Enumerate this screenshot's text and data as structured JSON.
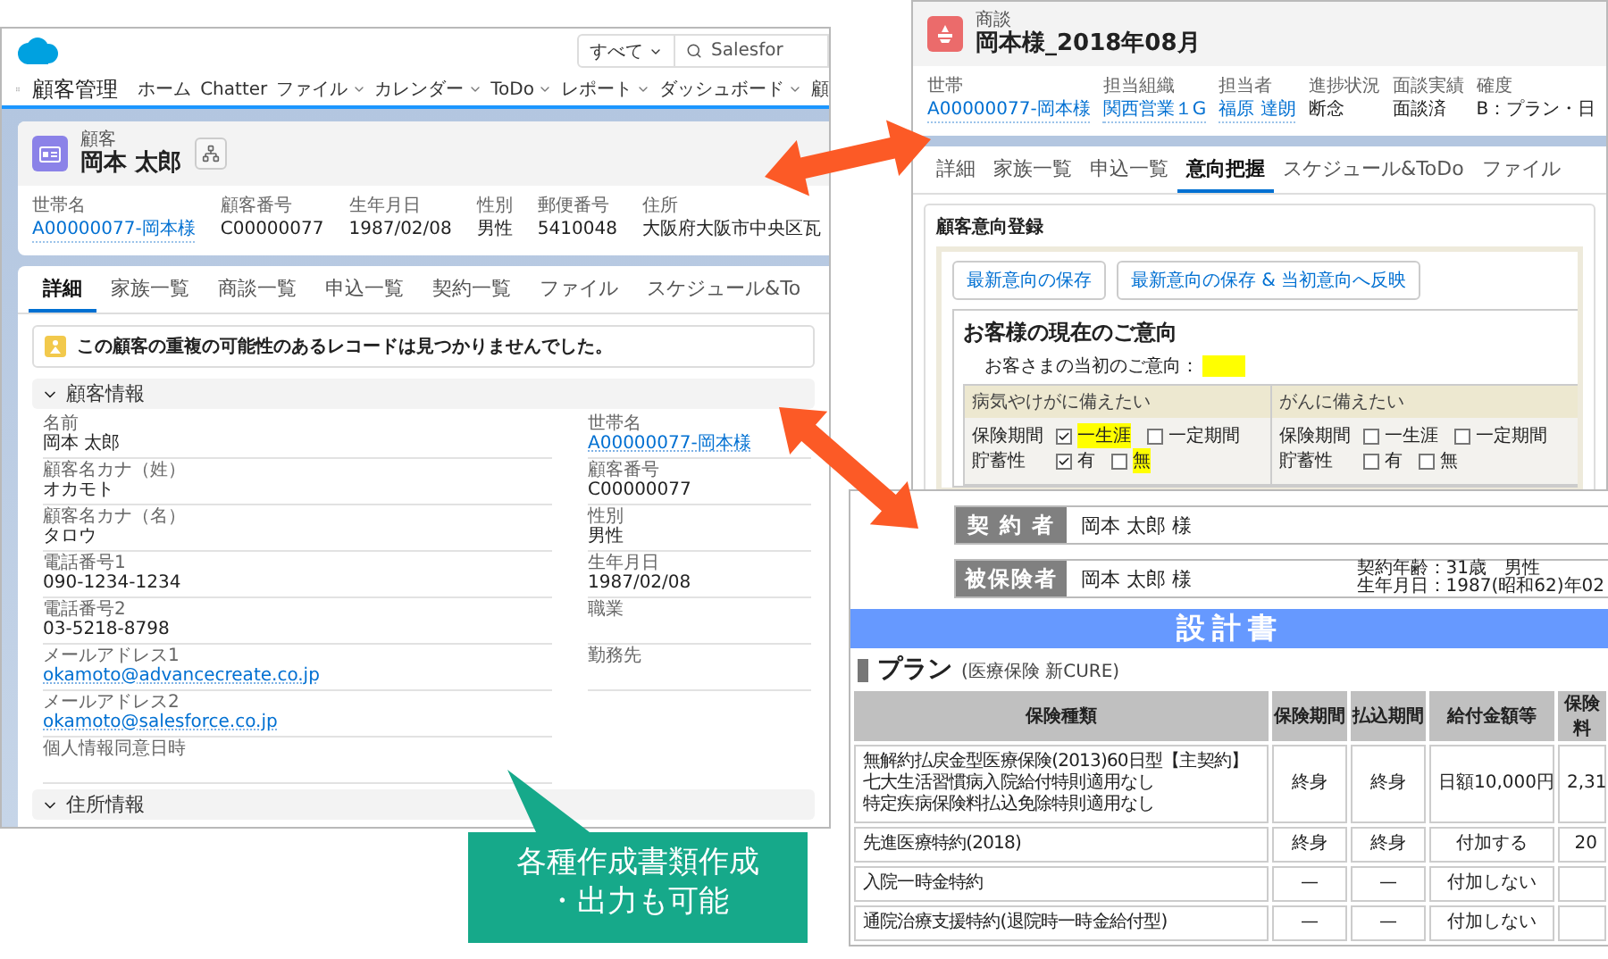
{
  "customer_window": {
    "search_scope": "すべて",
    "search_text": "Salesfor",
    "app_name": "顧客管理",
    "nav": [
      {
        "label": "ホーム",
        "menu": false
      },
      {
        "label": "Chatter",
        "menu": false
      },
      {
        "label": "ファイル",
        "menu": true
      },
      {
        "label": "カレンダー",
        "menu": true
      },
      {
        "label": "ToDo",
        "menu": true
      },
      {
        "label": "レポート",
        "menu": true
      },
      {
        "label": "ダッシュボード",
        "menu": true
      },
      {
        "label": "顧",
        "menu": false
      }
    ],
    "record_type": "顧客",
    "record_name": "岡本 太郎",
    "highlights": [
      {
        "label": "世帯名",
        "value": "A00000077-岡本様",
        "link": true
      },
      {
        "label": "顧客番号",
        "value": "C00000077",
        "link": false
      },
      {
        "label": "生年月日",
        "value": "1987/02/08",
        "link": false
      },
      {
        "label": "性別",
        "value": "男性",
        "link": false
      },
      {
        "label": "郵便番号",
        "value": "5410048",
        "link": false
      },
      {
        "label": "住所",
        "value": "大阪府大阪市中央区瓦",
        "link": false
      }
    ],
    "tabs": [
      {
        "label": "詳細",
        "selected": true
      },
      {
        "label": "家族一覧",
        "selected": false
      },
      {
        "label": "商談一覧",
        "selected": false
      },
      {
        "label": "申込一覧",
        "selected": false
      },
      {
        "label": "契約一覧",
        "selected": false
      },
      {
        "label": "ファイル",
        "selected": false
      },
      {
        "label": "スケジュール&To",
        "selected": false
      }
    ],
    "alert": "この顧客の重複の可能性のあるレコードは見つかりませんでした。",
    "section": "顧客情報",
    "left_fields": [
      {
        "label": "名前",
        "value": "岡本 太郎",
        "link": false
      },
      {
        "label": "顧客名カナ（姓）",
        "value": "オカモト",
        "link": false
      },
      {
        "label": "顧客名カナ（名）",
        "value": "タロウ",
        "link": false
      },
      {
        "label": "電話番号1",
        "value": "090-1234-1234",
        "link": false
      },
      {
        "label": "電話番号2",
        "value": "03-5218-8798",
        "link": false
      },
      {
        "label": "メールアドレス1",
        "value": "okamoto@advancecreate.co.jp",
        "link": true
      },
      {
        "label": "メールアドレス2",
        "value": "okamoto@salesforce.co.jp",
        "link": true
      },
      {
        "label": "個人情報同意日時"
      }
    ],
    "right_fields": [
      {
        "label": "世帯名",
        "value": "A00000077-岡本様",
        "link": true
      },
      {
        "label": "顧客番号",
        "value": "C00000077",
        "link": false
      },
      {
        "label": "性別",
        "value": "男性",
        "link": false
      },
      {
        "label": "生年月日",
        "value": "1987/02/08",
        "link": false
      },
      {
        "label": "職業"
      },
      {
        "label": "勤務先"
      }
    ],
    "next_section": "住所情報"
  },
  "opportunity_window": {
    "record_type": "商談",
    "record_name": "岡本様_2018年08月",
    "highlights": [
      {
        "label": "世帯",
        "value": "A00000077-岡本様",
        "link": true
      },
      {
        "label": "担当組織",
        "value": "関西営業１G",
        "link": true
      },
      {
        "label": "担当者",
        "value": "福原 達朗",
        "link": true
      },
      {
        "label": "進捗状況",
        "value": "断念",
        "link": false
      },
      {
        "label": "面談実績",
        "value": "面談済",
        "link": false
      },
      {
        "label": "確度",
        "value": "B：プラン・日",
        "link": false
      }
    ],
    "tabs": [
      {
        "label": "詳細",
        "selected": false
      },
      {
        "label": "家族一覧",
        "selected": false
      },
      {
        "label": "申込一覧",
        "selected": false
      },
      {
        "label": "意向把握",
        "selected": true
      },
      {
        "label": "スケジュール&ToDo",
        "selected": false
      },
      {
        "label": "ファイル",
        "selected": false
      }
    ],
    "panel_title": "顧客意向登録",
    "buttons": [
      "最新意向の保存",
      "最新意向の保存 & 当初意向へ反映"
    ],
    "intent_heading": "お客様の現在のご意向",
    "initial_intent_label": "お客さまの当初のご意向：",
    "intent_groups": [
      {
        "title": "病気やけがに備えたい",
        "rows": [
          {
            "label": "保険期間",
            "options": [
              {
                "label": "一生涯",
                "checked": true,
                "highlighted": true
              },
              {
                "label": "一定期間",
                "checked": false,
                "highlighted": false
              }
            ]
          },
          {
            "label": "貯蓄性",
            "options": [
              {
                "label": "有",
                "checked": true,
                "highlighted": false
              },
              {
                "label": "無",
                "checked": false,
                "highlighted": true
              }
            ]
          }
        ]
      },
      {
        "title": "がんに備えたい",
        "rows": [
          {
            "label": "保険期間",
            "options": [
              {
                "label": "一生涯",
                "checked": false,
                "highlighted": false
              },
              {
                "label": "一定期間",
                "checked": false,
                "highlighted": false
              }
            ]
          },
          {
            "label": "貯蓄性",
            "options": [
              {
                "label": "有",
                "checked": false,
                "highlighted": false
              },
              {
                "label": "無",
                "checked": false,
                "highlighted": false
              }
            ]
          }
        ]
      }
    ]
  },
  "proposal_window": {
    "contractor": {
      "label": "契 約 者",
      "name": "岡本 太郎 様"
    },
    "insured": {
      "label": "被保険者",
      "name": "岡本 太郎 様",
      "info_lines": [
        "契約年齢：31歳　男性",
        "生年月日：1987(昭和62)年02"
      ]
    },
    "title": "設計書",
    "plan_heading": "プラン",
    "plan_note": "(医療保険 新CURE)",
    "columns": [
      "保険種類",
      "保険期間",
      "払込期間",
      "給付金額等",
      "保険料"
    ],
    "rows": [
      {
        "type_lines": [
          "無解約払戻金型医療保険(2013)60日型【主契約】",
          "七大生活習慣病入院給付特則適用なし",
          "特定疾病保険料払込免除特則適用なし"
        ],
        "term": "終身",
        "payment": "終身",
        "benefit_label": "日額",
        "benefit": "10,000円",
        "premium": "2,31"
      },
      {
        "type_lines": [
          "先進医療特約(2018)"
        ],
        "term": "終身",
        "payment": "終身",
        "benefit": "付加する",
        "premium": "20"
      },
      {
        "type_lines": [
          "入院一時金特約"
        ],
        "term": "—",
        "payment": "—",
        "benefit": "付加しない"
      },
      {
        "type_lines": [
          "通院治療支援特約(退院時一時金給付型)"
        ],
        "term": "—",
        "payment": "—",
        "benefit": "付加しない"
      }
    ]
  },
  "callout": {
    "text": "各種作成書類作成・出力も可能"
  }
}
